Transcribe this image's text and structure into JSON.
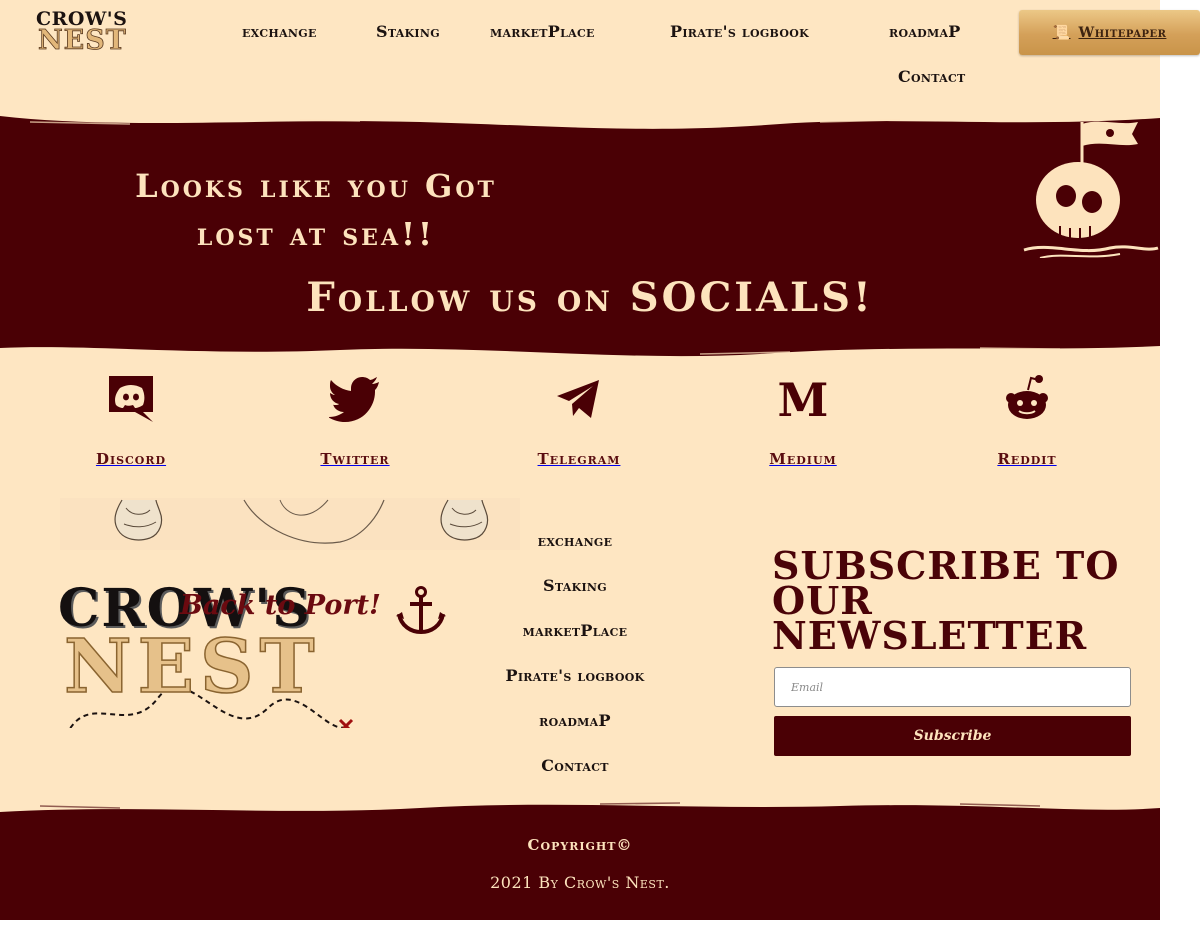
{
  "brand": {
    "logo_line1": "CROW'S",
    "logo_line2": "NEST"
  },
  "header": {
    "nav": [
      "exchange",
      "Staking",
      "marketPlace",
      "Pirate's logbook",
      "roadmaP",
      "Contact"
    ],
    "whitepaper_label": "Whitepaper",
    "whitepaper_icon": "scroll-icon"
  },
  "hero": {
    "title": "Looks like you Got lost at sea!!",
    "follow": "Follow us on SOCIALS!",
    "illustration": "skull-flag-illustration"
  },
  "socials": [
    {
      "label": "Discord",
      "icon": "discord-icon"
    },
    {
      "label": "Twitter",
      "icon": "twitter-icon"
    },
    {
      "label": "Telegram",
      "icon": "telegram-icon"
    },
    {
      "label": "Medium",
      "icon": "medium-icon"
    },
    {
      "label": "Reddit",
      "icon": "reddit-icon"
    }
  ],
  "footer": {
    "back_to_port": "Back to Port!",
    "nav": [
      "exchange",
      "Staking",
      "marketPlace",
      "Pirate's logbook",
      "roadmaP",
      "Contact"
    ],
    "newsletter_title": "Subscribe to our Newsletter",
    "email_placeholder": "Email",
    "subscribe_label": "Subscribe",
    "copyright": "Copyright©",
    "byline": "2021 By Crow's Nest."
  },
  "colors": {
    "cream": "#fee6c2",
    "maroon": "#4a0005",
    "gold": "#d4a059",
    "ink": "#1b1210"
  }
}
